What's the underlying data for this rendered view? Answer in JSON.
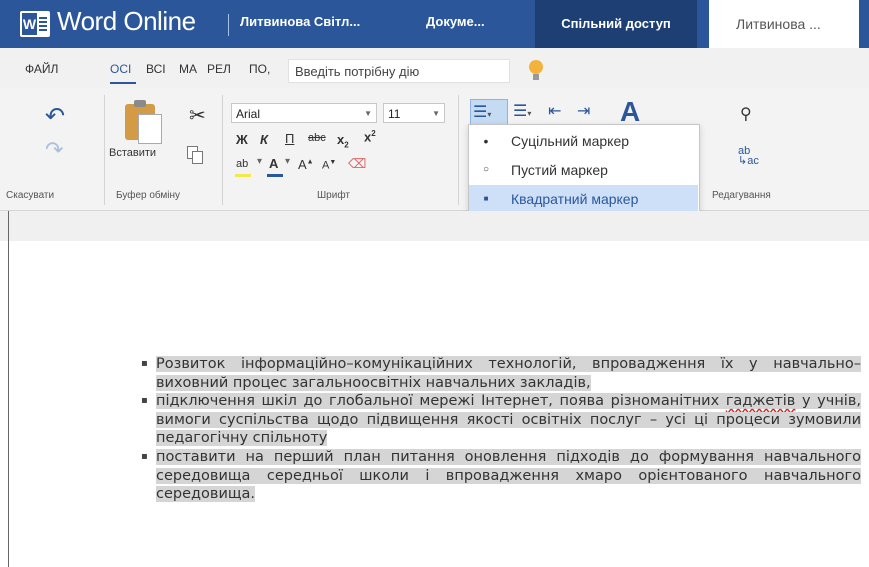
{
  "title_bar": {
    "app_name": "Word Online",
    "user_short": "Литвинова Світл...",
    "doc_name": "Докуме...",
    "share_label": "Спільний доступ",
    "user_name": "Литвинова ...",
    "brand_color": "#2b579a"
  },
  "tabs": [
    "ФАЙЛ",
    "ОСІ",
    "ВСІ",
    "МА",
    "РЕЛ",
    "ПО,"
  ],
  "tell_me": {
    "placeholder": "Введіть потрібну дію"
  },
  "ribbon": {
    "groups": {
      "undo": "Скасувати",
      "clipboard": "Буфер обміну",
      "font": "Шрифт",
      "editing": "Редагування"
    },
    "paste_label": "Вставити",
    "font_name": "Arial",
    "font_size": "11",
    "bold": "Ж",
    "italic": "К",
    "underline": "П",
    "strike": "abc",
    "subscript": "x",
    "superscript": "x",
    "highlight_glyph": "ab",
    "font_color_glyph": "A",
    "grow": "A",
    "shrink": "A",
    "styles_glyph": "A"
  },
  "bullet_menu": {
    "items": [
      {
        "mark": "•",
        "label": "Суцільний маркер"
      },
      {
        "mark": "○",
        "label": "Пустий маркер"
      },
      {
        "mark": "■",
        "label": "Квадратний маркер",
        "selected": true
      }
    ]
  },
  "document": {
    "items": [
      "Розвиток інформаційно–комунікаційних технологій, впровадження їх у навчально–виховний процес загальноосвітніх навчальних закладів,",
      "підключення шкіл до глобальної мережі Інтернет, поява різноманітних ",
      "гаджетів",
      " у учнів, вимоги суспільства щодо підвищення якості освітніх послуг – усі ці процеси зумовили педагогічну спільноту",
      "поставити на перший план питання оновлення підходів до формування навчального середовища середньої школи і впровадження хмаро орієнтованого навчального середовища."
    ]
  }
}
